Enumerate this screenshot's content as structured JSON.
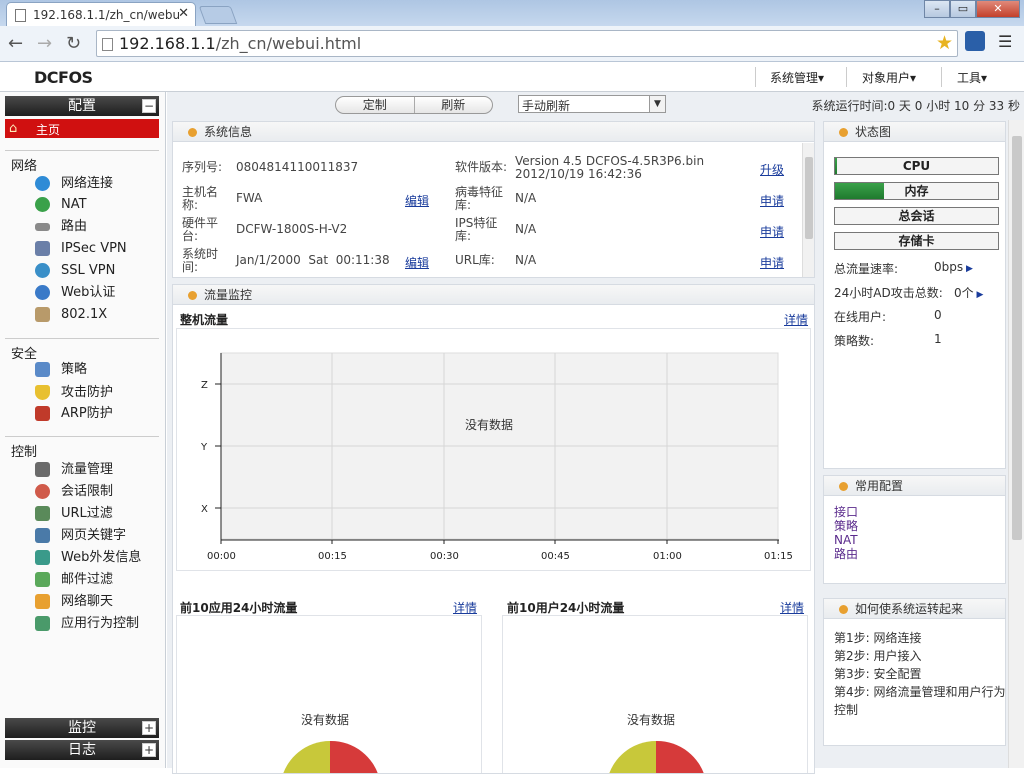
{
  "browser": {
    "tab_title": "192.168.1.1/zh_cn/webu",
    "url_host": "192.168.1.1",
    "url_path": "/zh_cn/webui.html"
  },
  "header": {
    "logo": "DCFOS",
    "menu": [
      "系统管理▾",
      "对象用户▾",
      "工具▾"
    ]
  },
  "sidebar": {
    "config_header": "配置",
    "home": "主页",
    "sections": [
      {
        "title": "网络",
        "items": [
          "网络连接",
          "NAT",
          "路由",
          "IPSec VPN",
          "SSL VPN",
          "Web认证",
          "802.1X"
        ]
      },
      {
        "title": "安全",
        "items": [
          "策略",
          "攻击防护",
          "ARP防护"
        ]
      },
      {
        "title": "控制",
        "items": [
          "流量管理",
          "会话限制",
          "URL过滤",
          "网页关键字",
          "Web外发信息",
          "邮件过滤",
          "网络聊天",
          "应用行为控制"
        ]
      }
    ],
    "monitor_header": "监控",
    "log_header": "日志"
  },
  "toolbar": {
    "customize": "定制",
    "refresh": "刷新",
    "refresh_mode": "手动刷新",
    "uptime": "系统运行时间:0 天 0 小时 10 分 33 秒"
  },
  "sysinfo": {
    "title": "系统信息",
    "serial_label": "序列号:",
    "serial_value": "0804814110011837",
    "hostname_label": "主机名称:",
    "hostname_value": "FWA",
    "hostname_edit": "编辑",
    "platform_label": "硬件平台:",
    "platform_value": "DCFW-1800S-H-V2",
    "time_label": "系统时间:",
    "time_value": "Jan/1/2000  Sat  00:11:38",
    "time_edit": "编辑",
    "sw_label": "软件版本:",
    "sw_value_1": "Version 4.5 DCFOS-4.5R3P6.bin",
    "sw_value_2": "2012/10/19 16:42:36",
    "sw_link": "升级",
    "av_label": "病毒特征库:",
    "av_value": "N/A",
    "av_link": "申请",
    "ips_label": "IPS特征库:",
    "ips_value": "N/A",
    "ips_link": "申请",
    "url_label": "URL库:",
    "url_value": "N/A",
    "url_link": "申请"
  },
  "traffic": {
    "title": "流量监控",
    "whole_title": "整机流量",
    "detail": "详情",
    "no_data": "没有数据",
    "y_ticks": [
      "Z",
      "Y",
      "X"
    ],
    "x_ticks": [
      "00:00",
      "00:15",
      "00:30",
      "00:45",
      "01:00",
      "01:15"
    ],
    "top_apps_title": "前10应用24小时流量",
    "top_users_title": "前10用户24小时流量"
  },
  "status": {
    "title": "状态图",
    "cpu": "CPU",
    "cpu_level": 0.01,
    "mem": "内存",
    "mem_level": 0.3,
    "sessions": "总会话",
    "storage": "存储卡",
    "rate_label": "总流量速率:",
    "rate_value": "0bps",
    "ad_label": "24小时AD攻击总数:",
    "ad_value": "0个",
    "online_label": "在线用户:",
    "online_value": "0",
    "policy_label": "策略数:",
    "policy_value": "1"
  },
  "common": {
    "title": "常用配置",
    "links": [
      "接口",
      "策略",
      "NAT",
      "路由"
    ]
  },
  "howto": {
    "title": "如何使系统运转起来",
    "steps": [
      "第1步: 网络连接",
      "第2步: 用户接入",
      "第3步: 安全配置",
      "第4步: 网络流量管理和用户行为控制"
    ]
  },
  "colors": {
    "accent_red": "#d01010",
    "dot_orange": "#e8a030",
    "pie_red": "#d63a3a",
    "pie_yellow": "#c8c83a"
  }
}
